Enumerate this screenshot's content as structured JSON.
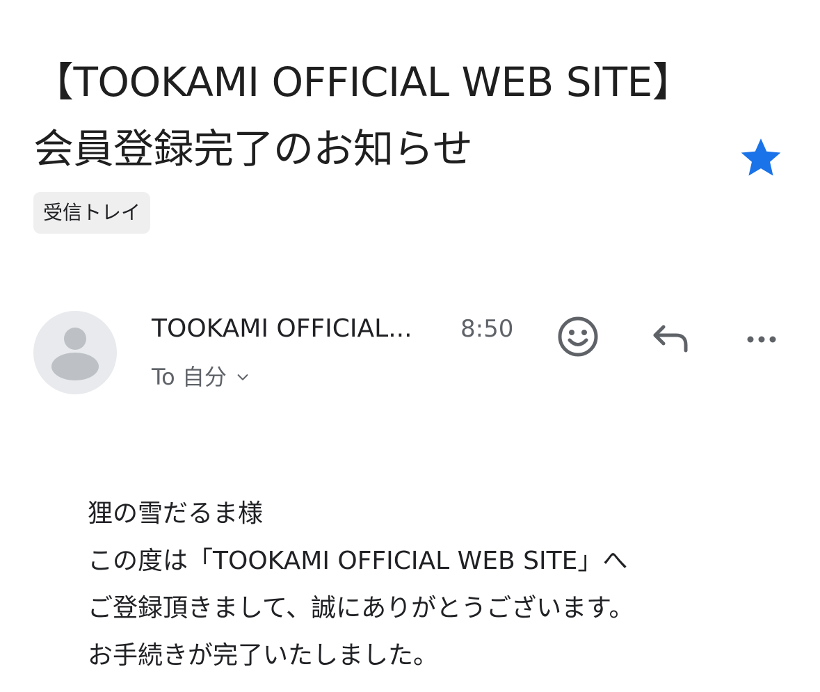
{
  "email": {
    "subject": "【TOOKAMI OFFICIAL WEB SITE】会員登録完了のお知らせ",
    "label": "受信トレイ",
    "starred": true,
    "star_color": "#1a73e8",
    "sender": "TOOKAMI OFFICIAL...",
    "time": "8:50",
    "recipient": "To 自分",
    "recipient_toggle_icon": "chevron-down-icon",
    "body_lines": [
      "狸の雪だるま様",
      "この度は「TOOKAMI OFFICIAL WEB SITE」へ",
      "ご登録頂きまして、誠にありがとうございます。",
      "お手続きが完了いたしました。"
    ]
  },
  "actions": {
    "emoji_icon": "smiley-icon",
    "reply_icon": "reply-icon",
    "more_icon": "more-horizontal-icon"
  }
}
